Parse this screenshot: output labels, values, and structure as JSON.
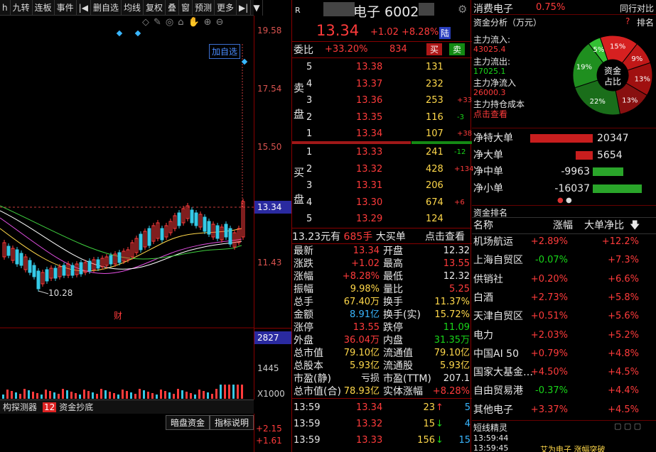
{
  "toolbar": {
    "items": [
      "h",
      "九转",
      "连板",
      "事件",
      "|◀",
      "删自选",
      "均线",
      "复权",
      "叠",
      "窗",
      "预测",
      "更多",
      "▶|",
      "▼"
    ]
  },
  "chart": {
    "add_watch_label": "加自选",
    "low_label": "10.28",
    "cai_label": "财",
    "price_ticks": [
      "19.58",
      "17.54",
      "15.50",
      "13.34",
      "11.43"
    ],
    "current_price_tag": "13.34",
    "volume_ticks": [
      "2827",
      "1445",
      "X1000"
    ],
    "bottom_tabs": [
      "构探测器",
      "12",
      "资金抄底"
    ],
    "dark_pool_btn": "暗盘资金",
    "indicator_btn": "指标说明",
    "right_ticks": [
      "+2.15",
      "+1.61"
    ]
  },
  "quote": {
    "header_r": "R",
    "name": "电子 6002",
    "price": "13.34",
    "change": "+1.02",
    "change_pct": "+8.28%",
    "market_tag": "陆",
    "weibi_label": "委比",
    "weibi_value": "+33.20%",
    "weicha_value": "834",
    "buy_btn": "买",
    "sell_btn": "卖",
    "sell_label_1": "卖",
    "sell_label_2": "盘",
    "buy_label_1": "买",
    "buy_label_2": "盘",
    "asks": [
      {
        "level": "5",
        "price": "13.38",
        "vol": "131",
        "chg": ""
      },
      {
        "level": "4",
        "price": "13.37",
        "vol": "232",
        "chg": ""
      },
      {
        "level": "3",
        "price": "13.36",
        "vol": "253",
        "chg": "+33"
      },
      {
        "level": "2",
        "price": "13.35",
        "vol": "116",
        "chg": "-3"
      },
      {
        "level": "1",
        "price": "13.34",
        "vol": "107",
        "chg": "+38"
      }
    ],
    "bids": [
      {
        "level": "1",
        "price": "13.33",
        "vol": "241",
        "chg": "-12"
      },
      {
        "level": "2",
        "price": "13.32",
        "vol": "428",
        "chg": "+134"
      },
      {
        "level": "3",
        "price": "13.31",
        "vol": "206",
        "chg": ""
      },
      {
        "level": "4",
        "price": "13.30",
        "vol": "674",
        "chg": "+6"
      },
      {
        "level": "5",
        "price": "13.29",
        "vol": "124",
        "chg": ""
      }
    ],
    "big_order": {
      "price_text": "13.23元有",
      "vol": "685手",
      "label": "大买单",
      "link": "点击查看"
    },
    "stats": [
      {
        "l1": "最新",
        "v1": "13.34",
        "c1": "red",
        "l2": "开盘",
        "v2": "12.32",
        "c2": "wht"
      },
      {
        "l1": "涨跌",
        "v1": "+1.02",
        "c1": "red",
        "l2": "最高",
        "v2": "13.55",
        "c2": "red"
      },
      {
        "l1": "涨幅",
        "v1": "+8.28%",
        "c1": "red",
        "l2": "最低",
        "v2": "12.32",
        "c2": "wht"
      },
      {
        "l1": "振幅",
        "v1": "9.98%",
        "c1": "yel",
        "l2": "量比",
        "v2": "5.25",
        "c2": "red"
      },
      {
        "l1": "总手",
        "v1": "67.40万",
        "c1": "yel",
        "l2": "换手",
        "v2": "11.37%",
        "c2": "yel"
      },
      {
        "l1": "金额",
        "v1": "8.91亿",
        "c1": "cyn",
        "l2": "换手(实)",
        "v2": "15.72%",
        "c2": "yel"
      },
      {
        "l1": "涨停",
        "v1": "13.55",
        "c1": "red",
        "l2": "跌停",
        "v2": "11.09",
        "c2": "grn"
      },
      {
        "l1": "外盘",
        "v1": "36.04万",
        "c1": "red",
        "l2": "内盘",
        "v2": "31.35万",
        "c2": "grn"
      },
      {
        "l1": "总市值",
        "v1": "79.10亿",
        "c1": "yel",
        "l2": "流通值",
        "v2": "79.10亿",
        "c2": "yel"
      },
      {
        "l1": "总股本",
        "v1": "5.93亿",
        "c1": "yel",
        "l2": "流通股",
        "v2": "5.93亿",
        "c2": "yel"
      },
      {
        "l1": "市盈(静)",
        "v1": "亏损",
        "c1": "wht",
        "l2": "市盈(TTM)",
        "v2": "207.1",
        "c2": "wht"
      },
      {
        "l1": "总市值(合)",
        "v1": "78.93亿",
        "c1": "yel",
        "l2": "实体涨幅",
        "v2": "+8.28%",
        "c2": "red"
      }
    ],
    "ticks": [
      {
        "time": "13:59",
        "price": "13.34",
        "vol": "23",
        "dir": "↑",
        "dcol": "red",
        "n": "5"
      },
      {
        "time": "13:59",
        "price": "13.32",
        "vol": "15",
        "dir": "↓",
        "dcol": "grn",
        "n": "4"
      },
      {
        "time": "13:59",
        "price": "13.33",
        "vol": "156",
        "dir": "↓",
        "dcol": "grn",
        "n": "15"
      }
    ]
  },
  "right": {
    "sector_name": "消费电子",
    "sector_pct": "0.75%",
    "sector_link": "同行对比",
    "fund_title": "资金分析（万元）",
    "help": "?",
    "rank_link": "排名",
    "inflow_label": "主力流入:",
    "inflow_value": "43025.4",
    "outflow_label": "主力流出:",
    "outflow_value": "17025.1",
    "net_label": "主力净流入",
    "net_value": "26000.3",
    "cost_label": "主力持仓成本",
    "cost_link": "点击查看",
    "pie_center_1": "资金",
    "pie_center_2": "占比",
    "pie_slices": [
      {
        "label": "15%",
        "value": 15,
        "color": "#d62020"
      },
      {
        "label": "9%",
        "value": 9,
        "color": "#c01818"
      },
      {
        "label": "13%",
        "value": 13,
        "color": "#a01010"
      },
      {
        "label": "13%",
        "value": 13,
        "color": "#881010"
      },
      {
        "label": "22%",
        "value": 22,
        "color": "#1a6e1a"
      },
      {
        "label": "19%",
        "value": 19,
        "color": "#1f8f1f"
      },
      {
        "label": "5%",
        "value": 5,
        "color": "#33c033"
      }
    ],
    "netflows": [
      {
        "label": "净特大单",
        "value": "20347",
        "num": 20347,
        "color": "#c81e1e",
        "vcol": "wht"
      },
      {
        "label": "净大单",
        "value": "5654",
        "num": 5654,
        "color": "#c81e1e",
        "vcol": "wht"
      },
      {
        "label": "净中单",
        "value": "-9963",
        "num": -9963,
        "color": "#2aa52a",
        "vcol": "wht"
      },
      {
        "label": "净小单",
        "value": "-16037",
        "num": -16037,
        "color": "#2aa52a",
        "vcol": "wht"
      }
    ],
    "rank_title": "资金排名",
    "rank_header": {
      "name": "名称",
      "pct": "涨幅",
      "net": "大单净比"
    },
    "rank_rows": [
      {
        "name": "机场航运",
        "pct": "+2.89%",
        "pc": "red",
        "net": "+12.2%"
      },
      {
        "name": "上海自贸区",
        "pct": "-0.07%",
        "pc": "grn",
        "net": "+7.3%"
      },
      {
        "name": "供销社",
        "pct": "+0.20%",
        "pc": "red",
        "net": "+6.6%"
      },
      {
        "name": "白酒",
        "pct": "+2.73%",
        "pc": "red",
        "net": "+5.8%"
      },
      {
        "name": "天津自贸区",
        "pct": "+0.51%",
        "pc": "red",
        "net": "+5.6%"
      },
      {
        "name": "电力",
        "pct": "+2.03%",
        "pc": "red",
        "net": "+5.2%"
      },
      {
        "name": "中国AI 50",
        "pct": "+0.79%",
        "pc": "red",
        "net": "+4.8%"
      },
      {
        "name": "国家大基金…",
        "pct": "+4.50%",
        "pc": "red",
        "net": "+4.5%"
      },
      {
        "name": "自由贸易港",
        "pct": "-0.37%",
        "pc": "grn",
        "net": "+4.4%"
      },
      {
        "name": "其他电子",
        "pct": "+3.37%",
        "pc": "red",
        "net": "+4.5%"
      }
    ],
    "sprite_title": "短线精灵",
    "sprite_rows": [
      {
        "time": "13:59:44",
        "text": ""
      },
      {
        "time": "13:59:45",
        "text": "艾为电子  涨幅突破"
      }
    ]
  }
}
